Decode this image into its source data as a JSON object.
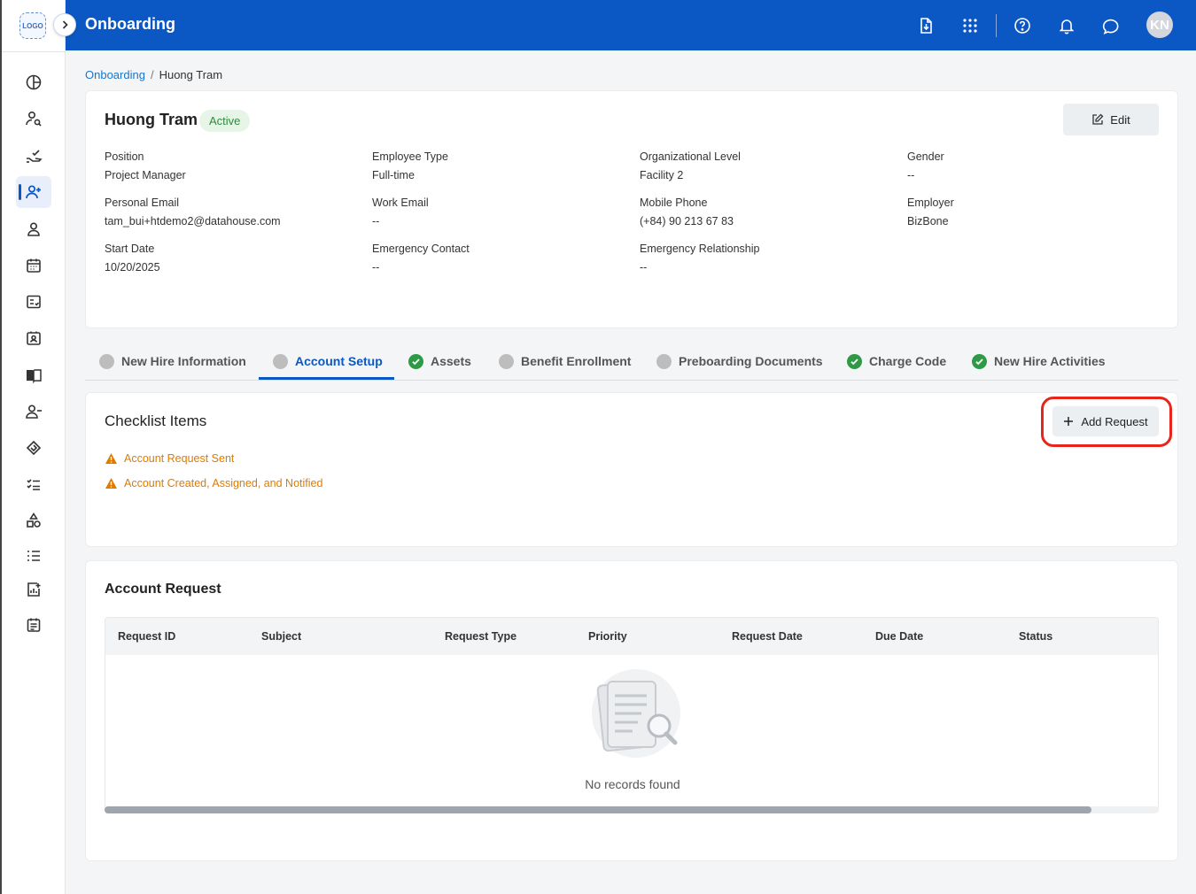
{
  "app": {
    "logo_text": "LOGO",
    "title": "Onboarding",
    "avatar_initials": "KN"
  },
  "colors": {
    "brand": "#0b57c4",
    "active_badge_bg": "#e6f5e7",
    "active_badge_text": "#2e8b3a",
    "warning": "#e07b00",
    "done": "#2e9a46",
    "pending": "#bdbdbd",
    "highlight": "#e8251a"
  },
  "sidebar": {
    "items": [
      {
        "icon": "dashboard-icon"
      },
      {
        "icon": "user-search-icon"
      },
      {
        "icon": "hand-check-icon"
      },
      {
        "icon": "user-add-icon",
        "active": true
      },
      {
        "icon": "user-icon"
      },
      {
        "icon": "calendar-icon"
      },
      {
        "icon": "checklist-board-icon"
      },
      {
        "icon": "id-card-icon"
      },
      {
        "icon": "book-icon"
      },
      {
        "icon": "user-remove-icon"
      },
      {
        "icon": "handshake-icon"
      },
      {
        "icon": "task-list-icon"
      },
      {
        "icon": "shapes-icon"
      },
      {
        "icon": "numbered-list-icon"
      },
      {
        "icon": "report-icon"
      },
      {
        "icon": "schedule-icon"
      }
    ]
  },
  "topbar": {
    "icons": [
      "download-icon",
      "apps-grid-icon",
      "help-icon",
      "notification-icon",
      "chat-icon"
    ]
  },
  "breadcrumb": {
    "root": "Onboarding",
    "sep": "/",
    "current": "Huong Tram"
  },
  "profile": {
    "name": "Huong Tram",
    "status": "Active",
    "edit_label": "Edit",
    "fields": {
      "position": {
        "label": "Position",
        "value": "Project Manager"
      },
      "employee_type": {
        "label": "Employee Type",
        "value": "Full-time"
      },
      "org_level": {
        "label": "Organizational Level",
        "value": "Facility 2"
      },
      "gender": {
        "label": "Gender",
        "value": "--"
      },
      "personal_email": {
        "label": "Personal Email",
        "value": "tam_bui+htdemo2@datahouse.com"
      },
      "work_email": {
        "label": "Work Email",
        "value": "--"
      },
      "mobile_phone": {
        "label": "Mobile Phone",
        "value": "(+84) 90 213 67 83"
      },
      "employer": {
        "label": "Employer",
        "value": "BizBone"
      },
      "start_date": {
        "label": "Start Date",
        "value": "10/20/2025"
      },
      "emergency_contact": {
        "label": "Emergency Contact",
        "value": "--"
      },
      "emergency_relationship": {
        "label": "Emergency Relationship",
        "value": "--"
      }
    }
  },
  "tabs": [
    {
      "label": "New Hire Information",
      "state": "pending"
    },
    {
      "label": "Account Setup",
      "state": "pending",
      "active": true
    },
    {
      "label": "Assets",
      "state": "done"
    },
    {
      "label": "Benefit Enrollment",
      "state": "pending"
    },
    {
      "label": "Preboarding Documents",
      "state": "pending"
    },
    {
      "label": "Charge Code",
      "state": "done"
    },
    {
      "label": "New Hire Activities",
      "state": "done"
    }
  ],
  "checklist": {
    "title": "Checklist Items",
    "add_label": "Add Request",
    "items": [
      "Account Request Sent",
      "Account Created, Assigned, and Notified"
    ]
  },
  "account_request": {
    "title": "Account Request",
    "columns": [
      "Request ID",
      "Subject",
      "Request Type",
      "Priority",
      "Request Date",
      "Due Date",
      "Status"
    ],
    "rows": [],
    "empty_text": "No records found"
  }
}
